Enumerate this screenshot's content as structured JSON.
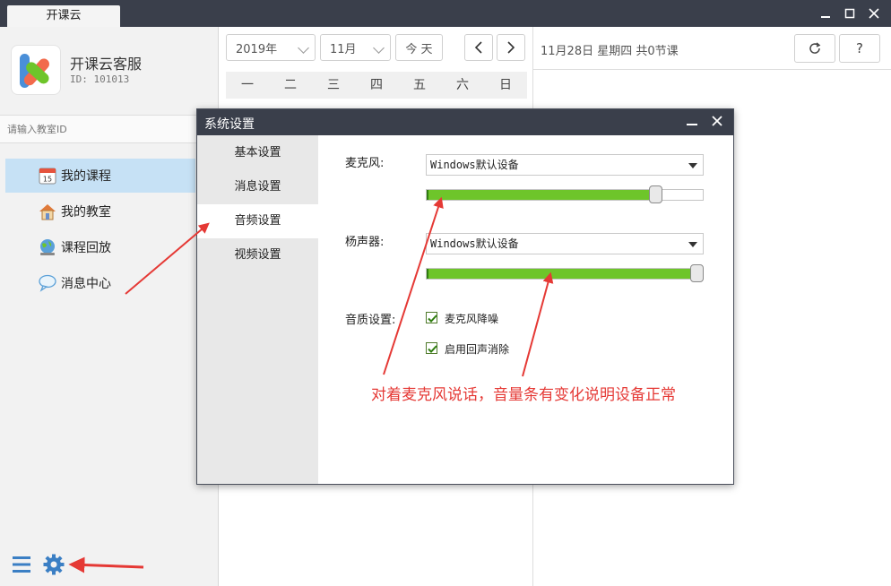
{
  "window": {
    "tab_label": "开课云",
    "minimize_icon": "minimize-icon",
    "maximize_icon": "maximize-icon",
    "close_icon": "close-icon"
  },
  "profile": {
    "name": "开课云客服",
    "id_label": "ID:",
    "id_value": "101013"
  },
  "search": {
    "placeholder": "请输入教室ID"
  },
  "nav": {
    "items": [
      {
        "label": "我的课程",
        "icon": "calendar-icon",
        "active": true
      },
      {
        "label": "我的教室",
        "icon": "house-icon",
        "active": false
      },
      {
        "label": "课程回放",
        "icon": "globe-icon",
        "active": false
      },
      {
        "label": "消息中心",
        "icon": "chat-bubble-icon",
        "active": false
      }
    ],
    "calendar_day": "15"
  },
  "calendar": {
    "year": "2019年",
    "month": "11月",
    "today_button": "今 天",
    "weekdays": [
      "一",
      "二",
      "三",
      "四",
      "五",
      "六",
      "日"
    ]
  },
  "day_summary": "11月28日 星期四 共0节课",
  "toolbar": {
    "refresh_icon": "refresh-icon",
    "help_label": "?"
  },
  "dialog": {
    "title": "系统设置",
    "side_items": [
      {
        "label": "基本设置",
        "active": false
      },
      {
        "label": "消息设置",
        "active": false
      },
      {
        "label": "音频设置",
        "active": true
      },
      {
        "label": "视频设置",
        "active": false
      }
    ],
    "mic_label": "麦克风:",
    "mic_device": "Windows默认设备",
    "mic_level": 0.83,
    "speaker_label": "杨声器:",
    "speaker_device": "Windows默认设备",
    "speaker_level": 1.0,
    "quality_label": "音质设置:",
    "noise_reduction_label": "麦克风降噪",
    "noise_reduction_checked": true,
    "echo_cancel_label": "启用回声消除",
    "echo_cancel_checked": true
  },
  "annotation": "对着麦克风说话，音量条有变化说明设备正常",
  "colors": {
    "titlebar": "#3a3f4b",
    "accent_green": "#6ec52a",
    "nav_active": "#c6e1f5",
    "annotation_red": "#e53935",
    "icon_blue": "#3b7fc4"
  }
}
